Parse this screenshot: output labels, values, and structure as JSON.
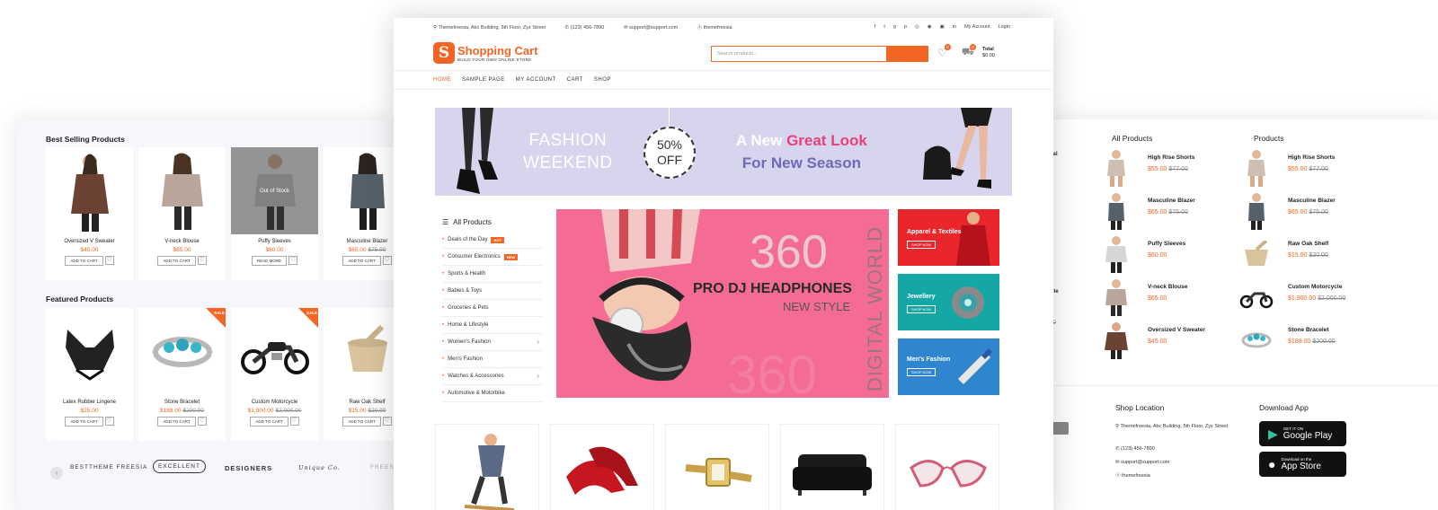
{
  "left_panel": {
    "best_selling_title": "Best Selling Products",
    "featured_title": "Featured Products",
    "best_selling": [
      {
        "name": "Oversized V Sweater",
        "price": "$45.00",
        "old": "",
        "button": "ADD TO CART"
      },
      {
        "name": "V-neck Blouse",
        "price": "$65.00",
        "old": "",
        "button": "ADD TO CART"
      },
      {
        "name": "Puffy Sleeves",
        "price": "$60.00",
        "old": "",
        "button": "READ MORE",
        "overlay": "Out of Stock"
      },
      {
        "name": "Masculine Blazer",
        "price": "$65.00",
        "old": "$75.00",
        "button": "ADD TO CART"
      }
    ],
    "featured": [
      {
        "name": "Latex Rubber Lingerie",
        "price": "$25.00",
        "old": "",
        "button": "ADD TO CART"
      },
      {
        "name": "Stone Bracelet",
        "price": "$188.00",
        "old": "$200.00",
        "button": "ADD TO CART",
        "sale": "SALE"
      },
      {
        "name": "Custom Motorcycle",
        "price": "$1,900.00",
        "old": "$2,000.00",
        "button": "ADD TO CART",
        "sale": "SALE"
      },
      {
        "name": "Raw Oak Shelf",
        "price": "$15.00",
        "old": "$20.00",
        "button": "ADD TO CART"
      }
    ],
    "brand_logos": [
      "BESTTHEME FREESIA",
      "EXCELLENT",
      "DESIGNERS",
      "Unique Co.",
      "FREESIA"
    ]
  },
  "topbar": {
    "address": "Themefreesia, Abc Building, 5th Floor, Zyz Street",
    "phone": "(123) 456-7890",
    "email": "support@support.com",
    "skype": "themefreesia",
    "social": [
      "f",
      "t",
      "g",
      "p",
      "◎",
      "◉",
      "▣",
      "in"
    ],
    "my_account": "My Account",
    "login": "Login"
  },
  "header": {
    "logo_letter": "S",
    "title": "Shopping Cart",
    "tagline": "BUILD YOUR OWN ONLINE STORE",
    "search_placeholder": "Search products...",
    "wishlist_count": "0",
    "cart_count": "0",
    "total_label": "Total",
    "total_value": "$0.00"
  },
  "nav": [
    "HOME",
    "SAMPLE PAGE",
    "MY ACCOUNT",
    "CART",
    "SHOP"
  ],
  "hero": {
    "line1": "FASHION",
    "line2": "WEEKEND",
    "discount": "50%",
    "off": "OFF",
    "a_new": "A New",
    "great_look": "Great Look",
    "season": "For New Season"
  },
  "categories": {
    "title": "All Products",
    "items": [
      {
        "label": "Deals of the Day",
        "badge": "HOT",
        "arrow": ""
      },
      {
        "label": "Consumer Electronics",
        "badge": "NEW",
        "arrow": ""
      },
      {
        "label": "Sports & Health",
        "badge": "",
        "arrow": ""
      },
      {
        "label": "Babies & Toys",
        "badge": "",
        "arrow": ""
      },
      {
        "label": "Groceries & Pets",
        "badge": "",
        "arrow": ""
      },
      {
        "label": "Home & Lifestyle",
        "badge": "",
        "arrow": ""
      },
      {
        "label": "Women's Fashion",
        "badge": "",
        "arrow": "›"
      },
      {
        "label": "Men's Fashion",
        "badge": "",
        "arrow": ""
      },
      {
        "label": "Watches & Accessories",
        "badge": "",
        "arrow": "›"
      },
      {
        "label": "Automotive & Motorbike",
        "badge": "",
        "arrow": ""
      }
    ]
  },
  "main_banner": {
    "big_num": "360",
    "title": "PRO DJ HEADPHONES",
    "subtitle": "NEW STYLE",
    "vertical": "DIGITAL WORLD",
    "faded_num": "360"
  },
  "promos": [
    {
      "title": "Apparel & Textiles",
      "button": "SHOP NOW",
      "color": "#e8262b"
    },
    {
      "title": "Jewellery",
      "button": "SHOP NOW",
      "color": "#14a7a5"
    },
    {
      "title": "Men's Fashion",
      "button": "SHOP NOW",
      "color": "#2f86cf"
    }
  ],
  "right_panel": {
    "col1_title": "All Products",
    "col2_title": "Products",
    "partial_left": [
      "Formal",
      "00",
      "00",
      "et",
      "00",
      "orcycle",
      "000.00",
      "lf",
      "00"
    ],
    "all_products": [
      {
        "name": "High Rise Shorts",
        "price": "$55.00",
        "old": "$77.00"
      },
      {
        "name": "Masculine Blazer",
        "price": "$65.00",
        "old": "$75.00"
      },
      {
        "name": "Puffy Sleeves",
        "price": "$60.00",
        "old": ""
      },
      {
        "name": "V-neck Blouse",
        "price": "$65.00",
        "old": ""
      },
      {
        "name": "Oversized V Sweater",
        "price": "$45.00",
        "old": ""
      }
    ],
    "products": [
      {
        "name": "High Rise Shorts",
        "price": "$55.00",
        "old": "$77.00"
      },
      {
        "name": "Masculine Blazer",
        "price": "$65.00",
        "old": "$75.00"
      },
      {
        "name": "Raw Oak Shelf",
        "price": "$15.00",
        "old": "$20.00"
      },
      {
        "name": "Custom Motorcycle",
        "price": "$1,900.00",
        "old": "$2,000.00"
      },
      {
        "name": "Stone Bracelet",
        "price": "$188.00",
        "old": "$200.00"
      }
    ],
    "shop_location_title": "Shop Location",
    "address": "Themefreesia, Abc Building, 5th Floor, Zyz Street",
    "phone": "(123) 456-7890",
    "email": "support@support.com",
    "skype": "themefreesia",
    "download_title": "Download App",
    "google_small": "GET IT ON",
    "google_big": "Google Play",
    "apple_small": "Download on the",
    "apple_big": "App Store"
  },
  "colors": {
    "accent": "#f26522",
    "hero_bg": "#d7d4ee",
    "banner_pink": "#f46c93",
    "great_look": "#e9407a",
    "season": "#6f6ab8"
  }
}
